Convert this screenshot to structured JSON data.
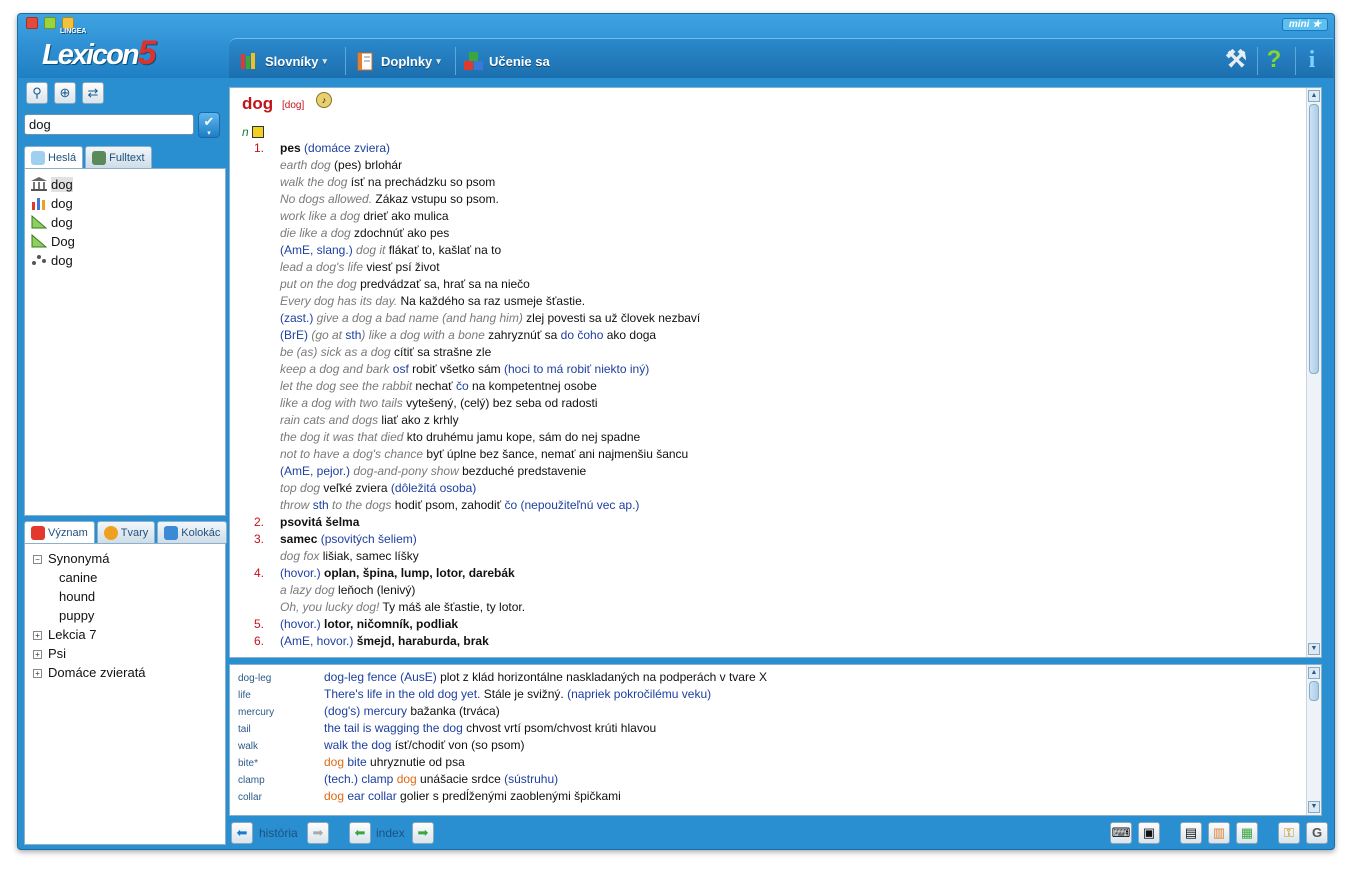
{
  "window": {
    "mini_label": "mini"
  },
  "logo": {
    "brand": "LINGEA",
    "name": "Lexicon",
    "version": "5"
  },
  "menu": [
    {
      "label": "Slovníky"
    },
    {
      "label": "Doplnky"
    },
    {
      "label": "Učenie sa"
    }
  ],
  "search": {
    "value": "dog"
  },
  "left_tabs": [
    {
      "label": "Heslá"
    },
    {
      "label": "Fulltext"
    }
  ],
  "headwords": [
    {
      "text": "dog",
      "icon": "museum-icon"
    },
    {
      "text": "dog",
      "icon": "chart-icon"
    },
    {
      "text": "dog",
      "icon": "ruler-icon"
    },
    {
      "text": "Dog",
      "icon": "ruler-icon"
    },
    {
      "text": "dog",
      "icon": "dots-icon"
    }
  ],
  "lower_tabs": [
    {
      "label": "Význam"
    },
    {
      "label": "Tvary"
    },
    {
      "label": "Kolokác"
    }
  ],
  "tree": {
    "synonyms_label": "Synonymá",
    "synonyms": [
      "canine",
      "hound",
      "puppy"
    ],
    "others": [
      "Lekcia 7",
      "Psi",
      "Domáce zvieratá"
    ]
  },
  "entry": {
    "headword": "dog",
    "pron": "[dog]",
    "pos": "n",
    "lines": [
      {
        "num": "1.",
        "parts": [
          [
            "b",
            "pes"
          ],
          [
            "tag",
            " (domáce zviera)"
          ]
        ]
      },
      {
        "num": "",
        "parts": [
          [
            "ex",
            "earth dog"
          ],
          [
            "",
            "  (pes) brlohár"
          ]
        ]
      },
      {
        "num": "",
        "parts": [
          [
            "ex",
            "walk the dog"
          ],
          [
            "",
            "  ísť na prechádzku so psom"
          ]
        ]
      },
      {
        "num": "",
        "parts": [
          [
            "ex",
            "No dogs allowed."
          ],
          [
            "",
            "  Zákaz vstupu so psom."
          ]
        ]
      },
      {
        "num": "",
        "parts": [
          [
            "ex",
            "work like a dog"
          ],
          [
            "",
            "  drieť ako mulica"
          ]
        ]
      },
      {
        "num": "",
        "parts": [
          [
            "ex",
            "die like a dog"
          ],
          [
            "",
            "  zdochnúť ako pes"
          ]
        ]
      },
      {
        "num": "",
        "parts": [
          [
            "tag",
            "(AmE, slang.)"
          ],
          [
            "ex",
            " dog it"
          ],
          [
            "",
            "  flákať to, kašlať na to"
          ]
        ]
      },
      {
        "num": "",
        "parts": [
          [
            "ex",
            "lead a dog's life"
          ],
          [
            "",
            "  viesť psí život"
          ]
        ]
      },
      {
        "num": "",
        "parts": [
          [
            "ex",
            "put on the dog"
          ],
          [
            "",
            "  predvádzať sa, hrať sa na niečo"
          ]
        ]
      },
      {
        "num": "",
        "parts": [
          [
            "ex",
            "Every dog has its day."
          ],
          [
            "",
            "  Na každého sa raz usmeje šťastie."
          ]
        ]
      },
      {
        "num": "",
        "parts": [
          [
            "tag",
            "(zast.)"
          ],
          [
            "ex",
            " give a dog a bad name (and hang him)"
          ],
          [
            "",
            "  zlej povesti sa už človek nezbaví"
          ]
        ]
      },
      {
        "num": "",
        "parts": [
          [
            "tag",
            "(BrE)"
          ],
          [
            "ex",
            " (go at "
          ],
          [
            "tag",
            "sth"
          ],
          [
            "ex",
            ") like a dog with a bone"
          ],
          [
            "",
            "  zahryznúť sa "
          ],
          [
            "tag",
            "do čoho"
          ],
          [
            "",
            " ako doga"
          ]
        ]
      },
      {
        "num": "",
        "parts": [
          [
            "ex",
            "be (as) sick as a dog"
          ],
          [
            "",
            "  cítiť sa strašne zle"
          ]
        ]
      },
      {
        "num": "",
        "parts": [
          [
            "ex",
            "keep a dog and bark "
          ],
          [
            "tag",
            "osf"
          ],
          [
            "",
            "  robiť všetko sám "
          ],
          [
            "tag",
            "(hoci to má robiť niekto iný)"
          ]
        ]
      },
      {
        "num": "",
        "parts": [
          [
            "ex",
            "let the dog see the rabbit"
          ],
          [
            "",
            "  nechať "
          ],
          [
            "tag",
            "čo"
          ],
          [
            "",
            " na kompetentnej osobe"
          ]
        ]
      },
      {
        "num": "",
        "parts": [
          [
            "ex",
            "like a dog with two tails"
          ],
          [
            "",
            "  vytešený, (celý) bez seba od radosti"
          ]
        ]
      },
      {
        "num": "",
        "parts": [
          [
            "ex",
            "rain cats and dogs"
          ],
          [
            "",
            "  liať ako z krhly"
          ]
        ]
      },
      {
        "num": "",
        "parts": [
          [
            "ex",
            "the dog it was that died"
          ],
          [
            "",
            "  kto druhému jamu kope, sám do nej spadne"
          ]
        ]
      },
      {
        "num": "",
        "parts": [
          [
            "ex",
            "not to have a dog's chance"
          ],
          [
            "",
            "  byť úplne bez šance, nemať ani najmenšiu šancu"
          ]
        ]
      },
      {
        "num": "",
        "parts": [
          [
            "tag",
            "(AmE, pejor.)"
          ],
          [
            "ex",
            " dog-and-pony show"
          ],
          [
            "",
            "  bezduché predstavenie"
          ]
        ]
      },
      {
        "num": "",
        "parts": [
          [
            "ex",
            "top dog"
          ],
          [
            "",
            "  veľké zviera "
          ],
          [
            "tag",
            "(dôležitá osoba)"
          ]
        ]
      },
      {
        "num": "",
        "parts": [
          [
            "ex",
            "throw "
          ],
          [
            "tag",
            "sth"
          ],
          [
            "ex",
            " to the dogs"
          ],
          [
            "",
            "  hodiť psom, zahodiť "
          ],
          [
            "tag",
            "čo"
          ],
          [
            "tag",
            " (nepoužiteľnú vec ap.)"
          ]
        ]
      },
      {
        "num": "2.",
        "parts": [
          [
            "b",
            "psovitá šelma"
          ]
        ]
      },
      {
        "num": "3.",
        "parts": [
          [
            "b",
            "samec"
          ],
          [
            "tag",
            " (psovitých šeliem)"
          ]
        ]
      },
      {
        "num": "",
        "parts": [
          [
            "ex",
            "dog fox"
          ],
          [
            "",
            "  lišiak, samec líšky"
          ]
        ]
      },
      {
        "num": "4.",
        "parts": [
          [
            "tag",
            "(hovor.)"
          ],
          [
            "b",
            "  oplan, špina, lump, lotor, darebák"
          ]
        ]
      },
      {
        "num": "",
        "parts": [
          [
            "ex",
            "a lazy dog"
          ],
          [
            "",
            "  leňoch (lenivý)"
          ]
        ]
      },
      {
        "num": "",
        "parts": [
          [
            "ex",
            "Oh, you lucky dog!"
          ],
          [
            "",
            "  Ty máš ale šťastie, ty lotor."
          ]
        ]
      },
      {
        "num": "5.",
        "parts": [
          [
            "tag",
            "(hovor.)"
          ],
          [
            "b",
            "  lotor, ničomník, podliak"
          ]
        ]
      },
      {
        "num": "6.",
        "parts": [
          [
            "tag",
            "(AmE, hovor.)"
          ],
          [
            "b",
            "  šmejd, haraburda, brak"
          ]
        ]
      }
    ]
  },
  "colloc": [
    {
      "key": "dog-leg",
      "parts": [
        [
          "ph",
          "dog-leg fence"
        ],
        [
          "ph",
          "  (AusE)"
        ],
        [
          "",
          " plot z klád horizontálne naskladaných na podperách v tvare X"
        ]
      ]
    },
    {
      "key": "life",
      "parts": [
        [
          "ph",
          "There's life in the old dog yet."
        ],
        [
          "",
          "  Stále je svižný. "
        ],
        [
          "ph",
          "(napriek pokročilému veku)"
        ]
      ]
    },
    {
      "key": "mercury",
      "parts": [
        [
          "ph",
          "(dog's) mercury"
        ],
        [
          "",
          "  bažanka (trváca)"
        ]
      ]
    },
    {
      "key": "tail",
      "parts": [
        [
          "ph",
          "the tail is wagging the dog"
        ],
        [
          "",
          "  chvost vrtí psom/chvost krúti hlavou"
        ]
      ]
    },
    {
      "key": "walk",
      "parts": [
        [
          "ph",
          "walk the dog"
        ],
        [
          "",
          "  ísť/chodiť von (so psom)"
        ]
      ]
    },
    {
      "key": "bite*",
      "parts": [
        [
          "or",
          "dog"
        ],
        [
          "ph",
          " bite"
        ],
        [
          "",
          "  uhryznutie od psa"
        ]
      ]
    },
    {
      "key": "clamp",
      "parts": [
        [
          "ph",
          "(tech.) clamp "
        ],
        [
          "or",
          "dog"
        ],
        [
          "",
          " unášacie srdce "
        ],
        [
          "ph",
          "(sústruhu)"
        ]
      ]
    },
    {
      "key": "collar",
      "parts": [
        [
          "or",
          "dog"
        ],
        [
          "ph",
          " ear collar"
        ],
        [
          "",
          "  golier s predĺženými zaoblenými špičkami"
        ]
      ]
    }
  ],
  "footer": {
    "history": "história",
    "index": "index"
  }
}
